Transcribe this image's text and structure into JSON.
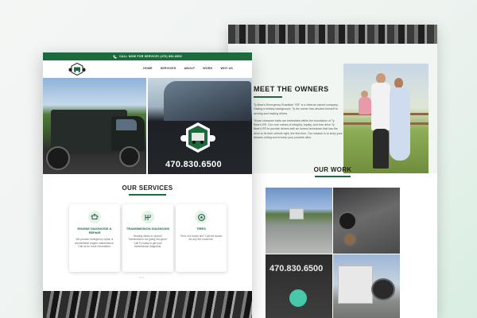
{
  "front": {
    "topbar": {
      "cta": "CALL NOW FOR SERVICE! (470) 830-6500"
    },
    "nav": {
      "links": [
        "HOME",
        "SERVICES",
        "ABOUT",
        "WORK",
        "WHY US"
      ]
    },
    "hero": {
      "phone": "470.830.6500"
    },
    "services": {
      "title": "OUR SERVICES",
      "cards": [
        {
          "title": "ENGINE DIAGNOSIS & REPAIR",
          "desc": "We provide emergency repair or preventative engine maintenance. Call us for more information.",
          "icon": "engine-icon"
        },
        {
          "title": "TRANSMISSION DIAGNOSIS",
          "desc": "Hearing clinks or clunks? Transmission not going into gear? Call Ty today to get your transmission diagnosis.",
          "icon": "transmission-icon"
        },
        {
          "title": "TIRES",
          "desc": "Tired of a blown tire? Call the doctor for any tire concerns.",
          "icon": "tire-icon"
        }
      ],
      "pager": "• • •"
    }
  },
  "back": {
    "owners": {
      "title": "MEET THE OWNERS",
      "paragraphs": [
        "Ty Bear's Emergency Roadside \"ER\" is a Veteran owned company. Having a military background, Ty the owner has devoted himself to serving and helping others.",
        "Those character traits are embedded within the foundation of Ty Bear's ER. Our core values of integrity, loyalty, and love drive Ty Bear's ER to provide drivers with an honest technician that has the drive to fix their vehicle right, the first time. Our mission is to keep your dreams rolling and to keep your pockets alive."
      ]
    },
    "work": {
      "title": "OUR WORK",
      "truck_phone": "470.830.6500"
    }
  },
  "colors": {
    "brand_green": "#1c6b3c",
    "card_icon_bg": "#e5f1e9"
  }
}
